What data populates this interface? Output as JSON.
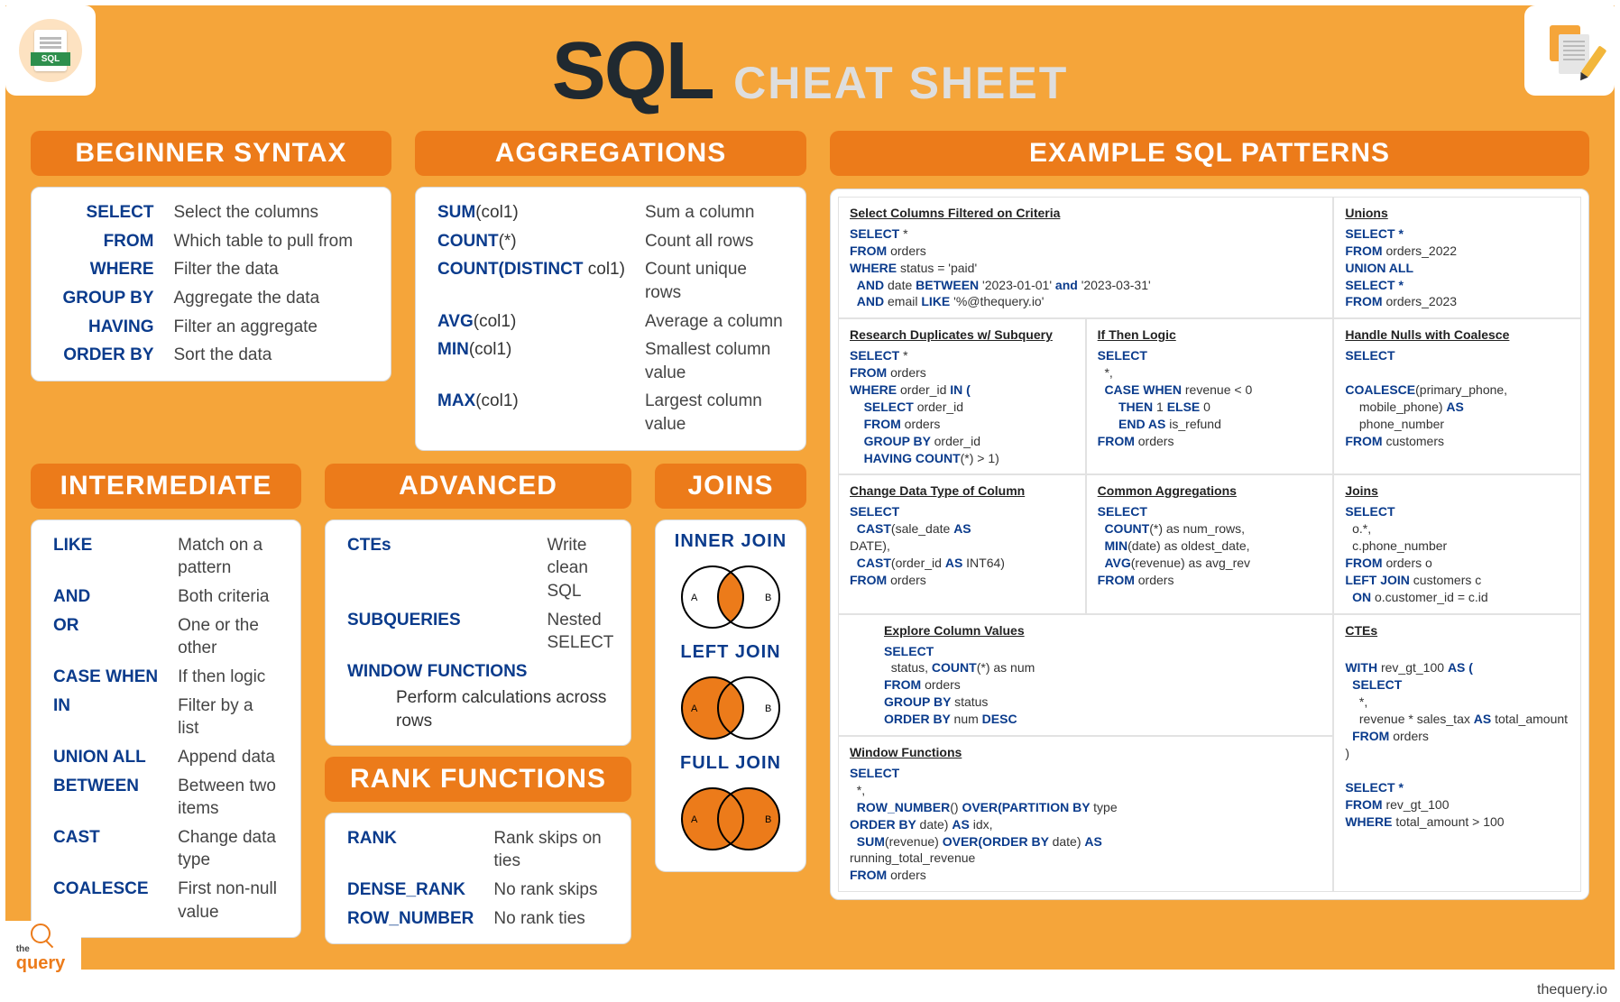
{
  "title_main": "SQL",
  "title_sub": "CHEAT SHEET",
  "footer_site": "thequery.io",
  "brand_small": "the",
  "brand_big": "query",
  "beginner": {
    "header": "BEGINNER SYNTAX",
    "rows": [
      {
        "k": "SELECT",
        "d": "Select the columns"
      },
      {
        "k": "FROM",
        "d": "Which table to pull from"
      },
      {
        "k": "WHERE",
        "d": "Filter the data"
      },
      {
        "k": "GROUP BY",
        "d": "Aggregate the data"
      },
      {
        "k": "HAVING",
        "d": "Filter an aggregate"
      },
      {
        "k": "ORDER BY",
        "d": "Sort the data"
      }
    ]
  },
  "aggregations": {
    "header": "AGGREGATIONS",
    "rows": [
      {
        "kb": "SUM",
        "ka": "(col1)",
        "d": "Sum a column"
      },
      {
        "kb": "COUNT",
        "ka": "(*)",
        "d": "Count all rows"
      },
      {
        "kb": "COUNT(DISTINCT",
        "ka": " col1)",
        "d": "Count unique rows"
      },
      {
        "kb": "AVG",
        "ka": "(col1)",
        "d": "Average a column"
      },
      {
        "kb": "MIN",
        "ka": "(col1)",
        "d": "Smallest column value"
      },
      {
        "kb": "MAX",
        "ka": "(col1)",
        "d": "Largest column value"
      }
    ]
  },
  "intermediate": {
    "header": "INTERMEDIATE",
    "rows": [
      {
        "k": "LIKE",
        "d": "Match on a pattern"
      },
      {
        "k": "AND",
        "d": "Both criteria"
      },
      {
        "k": "OR",
        "d": "One or the other"
      },
      {
        "k": "CASE WHEN",
        "d": "If then logic"
      },
      {
        "k": "IN",
        "d": "Filter by a list"
      },
      {
        "k": "UNION ALL",
        "d": "Append data"
      },
      {
        "k": "BETWEEN",
        "d": "Between two items"
      },
      {
        "k": "CAST",
        "d": "Change data type"
      },
      {
        "k": "COALESCE",
        "d": "First non-null value"
      }
    ]
  },
  "advanced": {
    "header": "ADVANCED",
    "rows": [
      {
        "k": "CTEs",
        "d": "Write clean SQL"
      },
      {
        "k": "SUBQUERIES",
        "d": "Nested SELECT"
      },
      {
        "k": "WINDOW FUNCTIONS",
        "d": ""
      }
    ],
    "window_note": "Perform calculations across rows"
  },
  "rank": {
    "header": "RANK FUNCTIONS",
    "rows": [
      {
        "k": "RANK",
        "d": "Rank skips on ties"
      },
      {
        "k": "DENSE_RANK",
        "d": "No rank skips"
      },
      {
        "k": "ROW_NUMBER",
        "d": "No rank ties"
      }
    ]
  },
  "joins": {
    "header": "JOINS",
    "inner": "INNER JOIN",
    "left": "LEFT JOIN",
    "full": "FULL  JOIN",
    "A": "A",
    "B": "B"
  },
  "patterns": {
    "header": "EXAMPLE SQL PATTERNS",
    "filter": {
      "t": "Select Columns Filtered on Criteria",
      "l1a": "SELECT ",
      "l1b": "*",
      "l2a": "FROM ",
      "l2b": "orders",
      "l3a": "WHERE ",
      "l3b": "status = 'paid'",
      "l4a": "AND ",
      "l4b": "date ",
      "l4c": "BETWEEN ",
      "l4d": "'2023-01-01' ",
      "l4e": "and ",
      "l4f": "'2023-03-31'",
      "l5a": "AND ",
      "l5b": "email ",
      "l5c": "LIKE ",
      "l5d": "'%@thequery.io'"
    },
    "unions": {
      "t": "Unions",
      "l1": "SELECT *",
      "l2a": "FROM ",
      "l2b": "orders_2022",
      "l3": "UNION ALL",
      "l4": "SELECT *",
      "l5a": "FROM ",
      "l5b": "orders_2023"
    },
    "dupes": {
      "t": "Research Duplicates w/ Subquery",
      "l1": "SELECT ",
      "l1b": "*",
      "l2a": "FROM ",
      "l2b": "orders",
      "l3a": "WHERE ",
      "l3b": "order_id ",
      "l3c": "IN (",
      "l4a": "SELECT ",
      "l4b": "order_id",
      "l5a": "FROM ",
      "l5b": "orders",
      "l6a": "GROUP BY ",
      "l6b": "order_id",
      "l7a": "HAVING COUNT",
      "l7b": "(*) > 1)"
    },
    "ifthen": {
      "t": "If Then Logic",
      "l1": "SELECT",
      "l2": "*,",
      "l3a": "CASE WHEN ",
      "l3b": "revenue < 0",
      "l4a": "THEN ",
      "l4b": "1 ",
      "l4c": "ELSE ",
      "l4d": "0",
      "l5a": "END AS ",
      "l5b": "is_refund",
      "l6a": "FROM ",
      "l6b": "orders"
    },
    "coalesce": {
      "t": "Handle Nulls with Coalesce",
      "l1": "SELECT",
      "l2": "",
      "l3a": "COALESCE",
      "l3b": "(primary_phone,",
      "l4": "mobile_phone) ",
      "l4b": "AS",
      "l5": "phone_number",
      "l6a": "FROM ",
      "l6b": "customers"
    },
    "cast": {
      "t": "Change Data Type of Column",
      "l1": "SELECT",
      "l2a": "CAST",
      "l2b": "(sale_date ",
      "l2c": "AS",
      "l3": "DATE),",
      "l4a": "CAST",
      "l4b": "(order_id ",
      "l4c": "AS ",
      "l4d": "INT64)",
      "l5a": "FROM ",
      "l5b": "orders"
    },
    "aggs": {
      "t": "Common Aggregations",
      "l1": "SELECT",
      "l2a": "COUNT",
      "l2b": "(*) as num_rows,",
      "l3a": "MIN",
      "l3b": "(date) as oldest_date,",
      "l4a": "AVG",
      "l4b": "(revenue) as avg_rev",
      "l5a": "FROM ",
      "l5b": "orders"
    },
    "joinsp": {
      "t": "Joins",
      "l1": "SELECT",
      "l2": "o.*,",
      "l3": "c.phone_number",
      "l4a": "FROM ",
      "l4b": "orders o",
      "l5a": "LEFT JOIN ",
      "l5b": "customers c",
      "l6a": "ON ",
      "l6b": "o.customer_id = c.id"
    },
    "explore": {
      "t": "Explore Column Values",
      "l1": "SELECT",
      "l2a": "status, ",
      "l2b": "COUNT",
      "l2c": "(*) as num",
      "l3a": "FROM ",
      "l3b": "orders",
      "l4a": "GROUP BY ",
      "l4b": "status",
      "l5a": "ORDER BY  ",
      "l5b": "num ",
      "l5c": "DESC"
    },
    "ctes": {
      "t": "CTEs",
      "l1a": "WITH ",
      "l1b": "rev_gt_100 ",
      "l1c": "AS (",
      "l2": "SELECT",
      "l3": "*,",
      "l4a": "revenue * sales_tax ",
      "l4b": "AS ",
      "l4c": "total_amount",
      "l5a": "FROM ",
      "l5b": "orders",
      "l6": ")",
      "l7": "SELECT *",
      "l8a": "FROM ",
      "l8b": "rev_gt_100",
      "l9a": "WHERE ",
      "l9b": "total_amount > 100"
    },
    "window": {
      "t": "Window Functions",
      "l1": "SELECT",
      "l2": "*,",
      "l3a": "ROW_NUMBER",
      "l3b": "() ",
      "l3c": "OVER(PARTITION BY ",
      "l3d": "type",
      "l4a": "ORDER BY ",
      "l4b": "date)  ",
      "l4c": "AS ",
      "l4d": "idx,",
      "l5a": "SUM",
      "l5b": "(revenue) ",
      "l5c": "OVER(ORDER BY ",
      "l5d": "date) ",
      "l5e": "AS",
      "l6": "running_total_revenue",
      "l7a": "FROM ",
      "l7b": "orders"
    }
  }
}
